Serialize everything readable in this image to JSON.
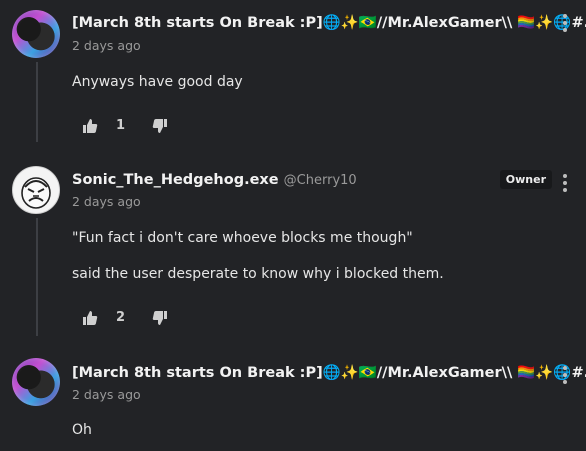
{
  "comments": [
    {
      "username": "[March 8th starts On Break :P]🌐✨🇧🇷//Mr.AlexGamer\\\\ 🏳️‍🌈✨🌐#...",
      "time": "2 days ago",
      "lines": [
        "Anyways have good day"
      ],
      "likes": "1",
      "avatar": "gamer-avatar"
    },
    {
      "username": "Sonic_The_Hedgehog.exe",
      "handle": "@Cherry10",
      "badge": "Owner",
      "time": "2 days ago",
      "lines": [
        "\"Fun fact i don't care whoeve blocks me though\"",
        "said the user desperate to know why i blocked them."
      ],
      "likes": "2",
      "avatar": "sonic-avatar"
    },
    {
      "username": "[March 8th starts On Break :P]🌐✨🇧🇷//Mr.AlexGamer\\\\ 🏳️‍🌈✨🌐#...",
      "time": "2 days ago",
      "lines": [
        "Oh"
      ],
      "avatar": "gamer-avatar"
    }
  ],
  "icons": {
    "like": "thumbs-up-icon",
    "dislike": "thumbs-down-icon",
    "menu": "more-vertical-icon"
  },
  "colors": {
    "background": "#222326",
    "text": "#e8e8e8",
    "muted": "#9a9a9a"
  }
}
